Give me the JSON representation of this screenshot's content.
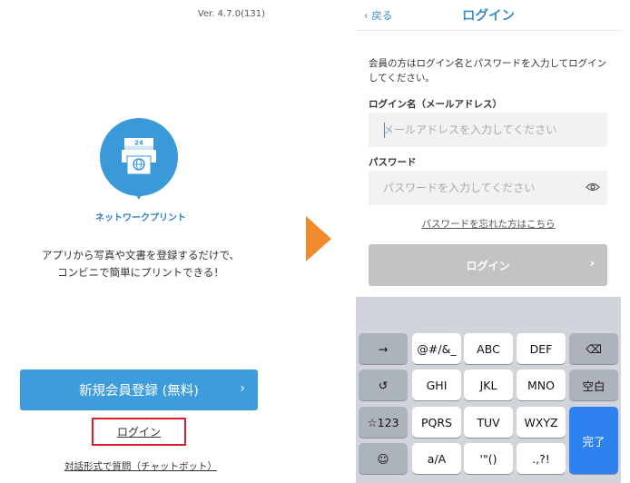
{
  "left_screen": {
    "version": "Ver. 4.7.0(131)",
    "logo_calendar_number": "24",
    "app_name": "ネットワークプリント",
    "tagline_line1": "アプリから写真や文書を登録するだけで、",
    "tagline_line2": "コンビニで簡単にプリントできる！",
    "register_button": "新規会員登録 (無料)",
    "login_link": "ログイン",
    "chat_link": "対話形式で質問（チャットボット）"
  },
  "right_screen": {
    "back_label": "戻る",
    "title": "ログイン",
    "intro_text": "会員の方はログイン名とパスワードを入力してログインしてください。",
    "login_name_label": "ログイン名（メールアドレス）",
    "email_placeholder": "メールアドレスを入力してください",
    "password_label": "パスワード",
    "password_placeholder": "パスワードを入力してください",
    "forgot_link": "パスワードを忘れた方はこちら",
    "login_button": "ログイン"
  },
  "keyboard": {
    "row1": [
      "→",
      "@#/&_",
      "ABC",
      "DEF",
      "⌫"
    ],
    "row2": [
      "↺",
      "GHI",
      "JKL",
      "MNO",
      "空白"
    ],
    "row3": [
      "☆123",
      "PQRS",
      "TUV",
      "WXYZ"
    ],
    "row4": [
      "☺",
      "a/A",
      "'\"()",
      ".,?!"
    ],
    "done": "完了"
  },
  "colors": {
    "accent_blue": "#3d9ddc",
    "highlight_red": "#d8202a",
    "arrow_orange": "#f08a2c",
    "disabled_gray": "#c3c3c3",
    "keyboard_blue": "#2d82f0"
  }
}
